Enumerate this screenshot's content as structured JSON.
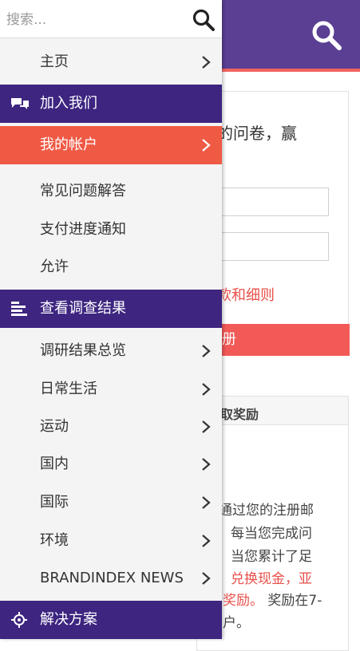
{
  "menu": {
    "search": {
      "placeholder": "搜索..."
    },
    "items": [
      {
        "label": "主页",
        "type": "link",
        "chevron": true
      },
      {
        "label": "加入我们",
        "type": "section",
        "icon": "chat-bubbles-icon"
      },
      {
        "label": "我的帐户",
        "type": "active",
        "chevron": true
      },
      {
        "label": "常见问题解答",
        "type": "link"
      },
      {
        "label": "支付进度通知",
        "type": "link"
      },
      {
        "label": "允许",
        "type": "link"
      },
      {
        "label": "查看调查结果",
        "type": "section",
        "icon": "bar-list-icon"
      },
      {
        "label": "调研结果总览",
        "type": "link",
        "chevron": true
      },
      {
        "label": "日常生活",
        "type": "link",
        "chevron": true
      },
      {
        "label": "运动",
        "type": "link",
        "chevron": true
      },
      {
        "label": "国内",
        "type": "link",
        "chevron": true
      },
      {
        "label": "国际",
        "type": "link",
        "chevron": true
      },
      {
        "label": "环境",
        "type": "link",
        "chevron": true
      },
      {
        "label": "BRANDINDEX NEWS",
        "type": "link",
        "chevron": true
      },
      {
        "label": "解决方案",
        "type": "section",
        "icon": "crosshair-icon"
      }
    ]
  },
  "page": {
    "header": {
      "search_icon": "search-icon",
      "color": "#5b3f93",
      "accent": "#f06560"
    },
    "registration": {
      "text_line1": "的问卷，赢",
      "terms_link": "款和细则",
      "register_button": "册"
    },
    "rewards": {
      "title": "取奖励",
      "lines": [
        {
          "text": "通过您的注册邮"
        },
        {
          "text": "每当您完成问"
        },
        {
          "text": "当您累计了足"
        },
        {
          "text": "兑换现金，亚",
          "highlight": true
        },
        {
          "text_red": "奖励。",
          "text": "奖励在7-"
        },
        {
          "text": "户。"
        }
      ]
    }
  },
  "colors": {
    "section_bg": "#3d2580",
    "active_bg": "#ef5a45",
    "menu_bg": "#f4f4f4"
  }
}
